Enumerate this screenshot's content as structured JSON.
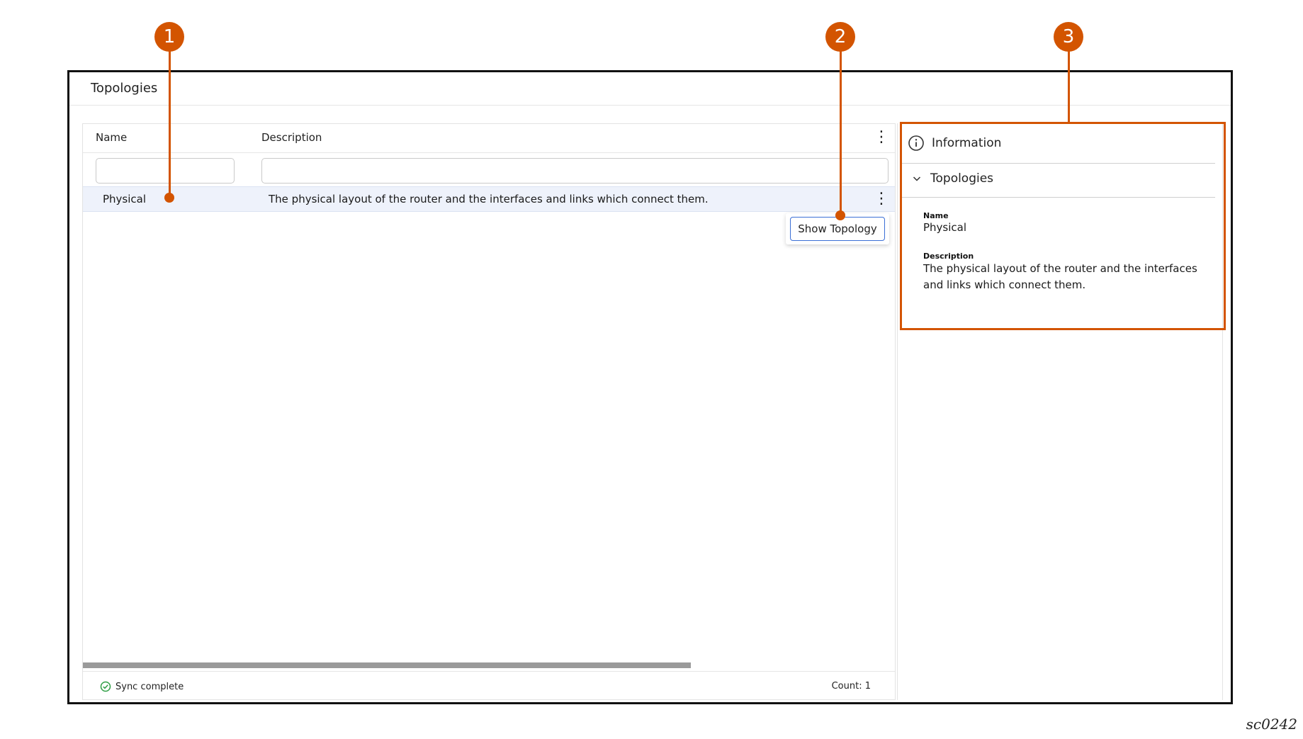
{
  "page": {
    "title": "Topologies"
  },
  "table": {
    "columns": [
      "Name",
      "Description"
    ],
    "rows": [
      {
        "name": "Physical",
        "description": "The physical layout of the router and the interfaces and links which connect them."
      }
    ],
    "row_action": "Show Topology",
    "status": "Sync complete",
    "count": "Count: 1"
  },
  "info_panel": {
    "header": "Information",
    "section": "Topologies",
    "fields": [
      {
        "label": "Name",
        "value": "Physical"
      },
      {
        "label": "Description",
        "value": "The physical layout of the router and the interfaces and links which connect them."
      }
    ]
  },
  "callouts": [
    "1",
    "2",
    "3"
  ],
  "figure_id": "sc0242",
  "colors": {
    "callout": "#d35400",
    "selected_row": "#eef2fb",
    "button_border": "#3b6fd6",
    "sync_ok": "#2e9e44"
  },
  "icons": [
    "info-icon",
    "chevron-down-icon",
    "kebab-menu-icon",
    "check-circle-icon"
  ]
}
